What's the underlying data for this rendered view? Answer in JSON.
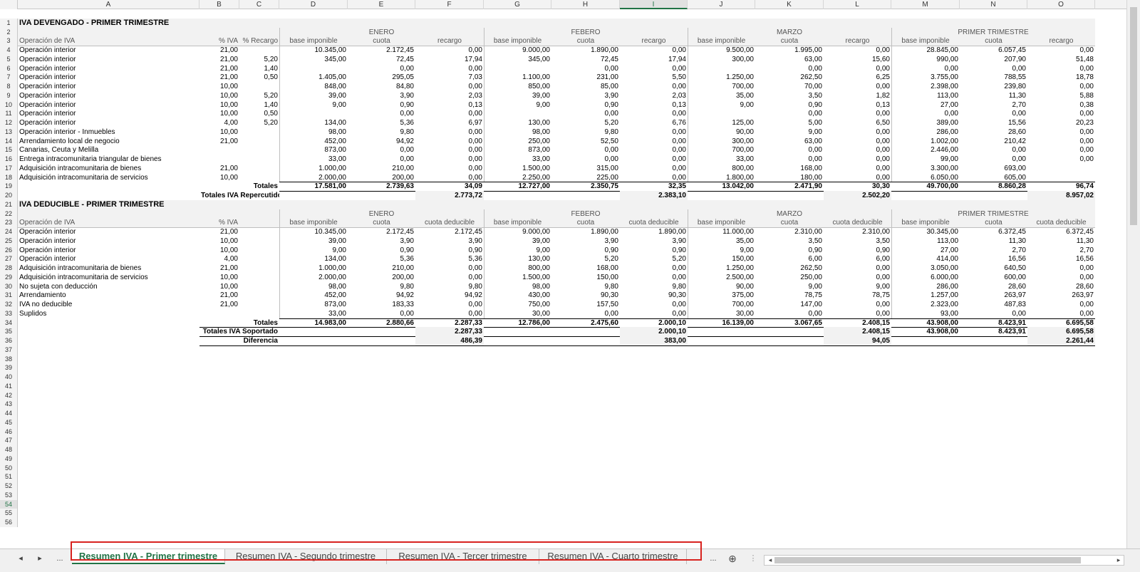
{
  "columns": [
    "A",
    "B",
    "C",
    "D",
    "E",
    "F",
    "G",
    "H",
    "I",
    "J",
    "K",
    "L",
    "M",
    "N",
    "O"
  ],
  "selected_column": "I",
  "selected_row": "54",
  "rows": [
    "1",
    "2",
    "3",
    "4",
    "5",
    "6",
    "7",
    "8",
    "9",
    "10",
    "11",
    "12",
    "13",
    "14",
    "15",
    "16",
    "17",
    "18",
    "19",
    "20",
    "21",
    "22",
    "23",
    "24",
    "25",
    "26",
    "27",
    "28",
    "29",
    "30",
    "31",
    "32",
    "33",
    "34",
    "35",
    "36",
    "37",
    "38",
    "39",
    "40",
    "41",
    "42",
    "43",
    "44",
    "45",
    "46",
    "47",
    "48",
    "49",
    "50",
    "51",
    "52",
    "53",
    "54",
    "55",
    "56"
  ],
  "section1": {
    "title": "IVA DEVENGADO - PRIMER TRIMESTRE",
    "months": [
      "ENERO",
      "FEBERO",
      "MARZO",
      "PRIMER TRIMESTRE"
    ],
    "headers": [
      "Operación de IVA",
      "% IVA",
      "% Recargo",
      "base imponible",
      "cuota",
      "recargo",
      "base imponible",
      "cuota",
      "recargo",
      "base imponible",
      "cuota",
      "recargo",
      "base imponible",
      "cuota",
      "recargo"
    ],
    "rows": [
      [
        "Operación interior",
        "21,00",
        "",
        "10.345,00",
        "2.172,45",
        "0,00",
        "9.000,00",
        "1.890,00",
        "0,00",
        "9.500,00",
        "1.995,00",
        "0,00",
        "28.845,00",
        "6.057,45",
        "0,00"
      ],
      [
        "Operación interior",
        "21,00",
        "5,20",
        "345,00",
        "72,45",
        "17,94",
        "345,00",
        "72,45",
        "17,94",
        "300,00",
        "63,00",
        "15,60",
        "990,00",
        "207,90",
        "51,48"
      ],
      [
        "Operación interior",
        "21,00",
        "1,40",
        "",
        "0,00",
        "0,00",
        "",
        "0,00",
        "0,00",
        "",
        "0,00",
        "0,00",
        "0,00",
        "0,00",
        "0,00"
      ],
      [
        "Operación interior",
        "21,00",
        "0,50",
        "1.405,00",
        "295,05",
        "7,03",
        "1.100,00",
        "231,00",
        "5,50",
        "1.250,00",
        "262,50",
        "6,25",
        "3.755,00",
        "788,55",
        "18,78"
      ],
      [
        "Operación interior",
        "10,00",
        "",
        "848,00",
        "84,80",
        "0,00",
        "850,00",
        "85,00",
        "0,00",
        "700,00",
        "70,00",
        "0,00",
        "2.398,00",
        "239,80",
        "0,00"
      ],
      [
        "Operación interior",
        "10,00",
        "5,20",
        "39,00",
        "3,90",
        "2,03",
        "39,00",
        "3,90",
        "2,03",
        "35,00",
        "3,50",
        "1,82",
        "113,00",
        "11,30",
        "5,88"
      ],
      [
        "Operación interior",
        "10,00",
        "1,40",
        "9,00",
        "0,90",
        "0,13",
        "9,00",
        "0,90",
        "0,13",
        "9,00",
        "0,90",
        "0,13",
        "27,00",
        "2,70",
        "0,38"
      ],
      [
        "Operación interior",
        "10,00",
        "0,50",
        "",
        "0,00",
        "0,00",
        "",
        "0,00",
        "0,00",
        "",
        "0,00",
        "0,00",
        "0,00",
        "0,00",
        "0,00"
      ],
      [
        "Operación interior",
        "4,00",
        "5,20",
        "134,00",
        "5,36",
        "6,97",
        "130,00",
        "5,20",
        "6,76",
        "125,00",
        "5,00",
        "6,50",
        "389,00",
        "15,56",
        "20,23"
      ],
      [
        "Operación interior - Inmuebles",
        "10,00",
        "",
        "98,00",
        "9,80",
        "0,00",
        "98,00",
        "9,80",
        "0,00",
        "90,00",
        "9,00",
        "0,00",
        "286,00",
        "28,60",
        "0,00"
      ],
      [
        "Arrendamiento local de negocio",
        "21,00",
        "",
        "452,00",
        "94,92",
        "0,00",
        "250,00",
        "52,50",
        "0,00",
        "300,00",
        "63,00",
        "0,00",
        "1.002,00",
        "210,42",
        "0,00"
      ],
      [
        "Canarias, Ceuta y Melilla",
        "",
        "",
        "873,00",
        "0,00",
        "0,00",
        "873,00",
        "0,00",
        "0,00",
        "700,00",
        "0,00",
        "0,00",
        "2.446,00",
        "0,00",
        "0,00"
      ],
      [
        "Entrega intracomunitaria triangular de bienes",
        "",
        "",
        "33,00",
        "0,00",
        "0,00",
        "33,00",
        "0,00",
        "0,00",
        "33,00",
        "0,00",
        "0,00",
        "99,00",
        "0,00",
        "0,00"
      ],
      [
        "Adquisición intracomunitaria de bienes",
        "21,00",
        "",
        "1.000,00",
        "210,00",
        "0,00",
        "1.500,00",
        "315,00",
        "0,00",
        "800,00",
        "168,00",
        "0,00",
        "3.300,00",
        "693,00",
        ""
      ],
      [
        "Adquisición intracomunitaria de servicios",
        "10,00",
        "",
        "2.000,00",
        "200,00",
        "0,00",
        "2.250,00",
        "225,00",
        "0,00",
        "1.800,00",
        "180,00",
        "0,00",
        "6.050,00",
        "605,00",
        ""
      ]
    ],
    "totals_label": "Totales",
    "totals": [
      "17.581,00",
      "2.739,63",
      "34,09",
      "12.727,00",
      "2.350,75",
      "32,35",
      "13.042,00",
      "2.471,90",
      "30,30",
      "49.700,00",
      "8.860,28",
      "96,74"
    ],
    "repercutido_label": "Totales IVA Repercutido",
    "repercutido": [
      "2.773,72",
      "2.383,10",
      "2.502,20",
      "8.957,02"
    ]
  },
  "section2": {
    "title": "IVA DEDUCIBLE - PRIMER TRIMESTRE",
    "months": [
      "ENERO",
      "FEBERO",
      "MARZO",
      "PRIMER TRIMESTRE"
    ],
    "headers": [
      "Operación de IVA",
      "% IVA",
      "",
      "base imponible",
      "cuota",
      "cuota deducible",
      "base imponible",
      "cuota",
      "cuota deducible",
      "base imponible",
      "cuota",
      "cuota deducible",
      "base imponible",
      "cuota",
      "cuota deducible"
    ],
    "rows": [
      [
        "Operación interior",
        "21,00",
        "",
        "10.345,00",
        "2.172,45",
        "2.172,45",
        "9.000,00",
        "1.890,00",
        "1.890,00",
        "11.000,00",
        "2.310,00",
        "2.310,00",
        "30.345,00",
        "6.372,45",
        "6.372,45"
      ],
      [
        "Operación interior",
        "10,00",
        "",
        "39,00",
        "3,90",
        "3,90",
        "39,00",
        "3,90",
        "3,90",
        "35,00",
        "3,50",
        "3,50",
        "113,00",
        "11,30",
        "11,30"
      ],
      [
        "Operación interior",
        "10,00",
        "",
        "9,00",
        "0,90",
        "0,90",
        "9,00",
        "0,90",
        "0,90",
        "9,00",
        "0,90",
        "0,90",
        "27,00",
        "2,70",
        "2,70"
      ],
      [
        "Operación interior",
        "4,00",
        "",
        "134,00",
        "5,36",
        "5,36",
        "130,00",
        "5,20",
        "5,20",
        "150,00",
        "6,00",
        "6,00",
        "414,00",
        "16,56",
        "16,56"
      ],
      [
        "Adquisición intracomunitaria de bienes",
        "21,00",
        "",
        "1.000,00",
        "210,00",
        "0,00",
        "800,00",
        "168,00",
        "0,00",
        "1.250,00",
        "262,50",
        "0,00",
        "3.050,00",
        "640,50",
        "0,00"
      ],
      [
        "Adquisición intracomunitaria de servicios",
        "10,00",
        "",
        "2.000,00",
        "200,00",
        "0,00",
        "1.500,00",
        "150,00",
        "0,00",
        "2.500,00",
        "250,00",
        "0,00",
        "6.000,00",
        "600,00",
        "0,00"
      ],
      [
        "No sujeta con deducción",
        "10,00",
        "",
        "98,00",
        "9,80",
        "9,80",
        "98,00",
        "9,80",
        "9,80",
        "90,00",
        "9,00",
        "9,00",
        "286,00",
        "28,60",
        "28,60"
      ],
      [
        "Arrendamiento",
        "21,00",
        "",
        "452,00",
        "94,92",
        "94,92",
        "430,00",
        "90,30",
        "90,30",
        "375,00",
        "78,75",
        "78,75",
        "1.257,00",
        "263,97",
        "263,97"
      ],
      [
        "IVA no deducible",
        "21,00",
        "",
        "873,00",
        "183,33",
        "0,00",
        "750,00",
        "157,50",
        "0,00",
        "700,00",
        "147,00",
        "0,00",
        "2.323,00",
        "487,83",
        "0,00"
      ],
      [
        "Suplidos",
        "",
        "",
        "33,00",
        "0,00",
        "0,00",
        "30,00",
        "0,00",
        "0,00",
        "30,00",
        "0,00",
        "0,00",
        "93,00",
        "0,00",
        "0,00"
      ]
    ],
    "totals_label": "Totales",
    "totals": [
      "14.983,00",
      "2.880,66",
      "2.287,33",
      "12.786,00",
      "2.475,60",
      "2.000,10",
      "16.139,00",
      "3.067,65",
      "2.408,15",
      "43.908,00",
      "8.423,91",
      "6.695,58"
    ],
    "soportado_label": "Totales IVA Soportado",
    "soportado": [
      "",
      "",
      "2.287,33",
      "",
      "",
      "2.000,10",
      "",
      "",
      "2.408,15",
      "43.908,00",
      "8.423,91",
      "6.695,58"
    ],
    "diferencia_label": "Diferencia",
    "diferencia": [
      "486,39",
      "383,00",
      "94,05",
      "2.261,44"
    ]
  },
  "tabs": {
    "first_label": "◂",
    "next_label": "▸",
    "more_left": "...",
    "more_right": "...",
    "add_label": "⊕",
    "sheets": [
      "Resumen IVA - Primer trimestre",
      "Resumen IVA - Segundo trimestre",
      "Resumen IVA - Tercer trimestre",
      "Resumen IVA - Cuarto trimestre"
    ],
    "active_index": 0,
    "accent": "#217346",
    "highlight": "#d8231f"
  }
}
